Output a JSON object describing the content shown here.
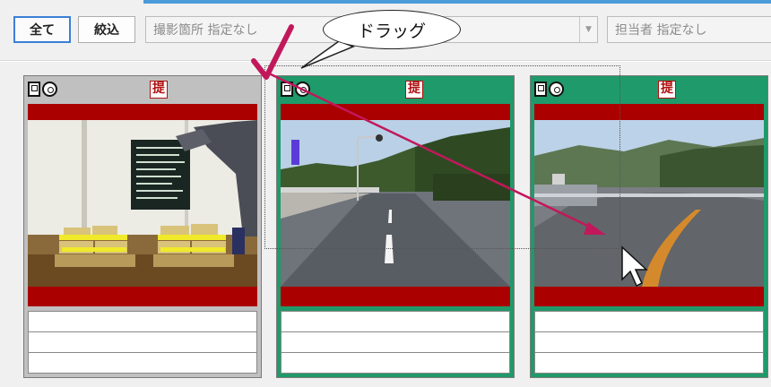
{
  "toolbar": {
    "all_label": "全て",
    "filter_label": "絞込",
    "location_combo": "撮影箇所 指定なし",
    "person_combo": "担当者 指定なし"
  },
  "callout": {
    "text": "ドラッグ"
  },
  "cards": [
    {
      "tei": "提",
      "selected": false,
      "photo": "construction-materials"
    },
    {
      "tei": "提",
      "selected": true,
      "photo": "road-straight"
    },
    {
      "tei": "提",
      "selected": true,
      "photo": "road-curve"
    }
  ],
  "icons": {
    "doc": "photo-doc-icon",
    "cd": "disc-icon",
    "check": "checkmark-icon",
    "cursor": "mouse-cursor-icon"
  },
  "colors": {
    "accent": "#3c7fd6",
    "card_selected": "#1f9a6a",
    "card_unselected": "#c0c0c0",
    "band_red": "#aa0000",
    "arrow": "#c2185b"
  }
}
